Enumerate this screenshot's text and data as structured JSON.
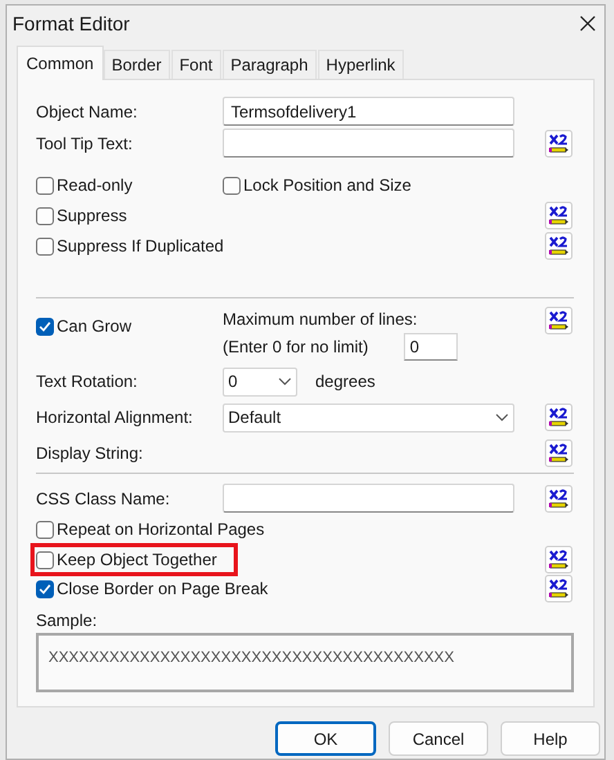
{
  "window": {
    "title": "Format Editor"
  },
  "tabs": [
    {
      "label": "Common",
      "selected": true
    },
    {
      "label": "Border",
      "selected": false
    },
    {
      "label": "Font",
      "selected": false
    },
    {
      "label": "Paragraph",
      "selected": false
    },
    {
      "label": "Hyperlink",
      "selected": false
    }
  ],
  "rows": [
    {
      "kind": "text",
      "label": "Object Name:",
      "value": "Termsofdelivery1",
      "formula": false
    },
    {
      "kind": "text",
      "label": "Tool Tip Text:",
      "formula": true
    },
    {
      "kind": "checks",
      "items": [
        {
          "label": "Read-only",
          "checked": false
        },
        {
          "label": "Lock Position and Size",
          "checked": false
        }
      ],
      "formula": false
    },
    {
      "kind": "check",
      "label": "Suppress",
      "checked": false,
      "formula": true,
      "highlighted": false
    },
    {
      "kind": "check",
      "label": "Suppress If Duplicated",
      "checked": false,
      "formula": true,
      "highlighted": false
    },
    {
      "kind": "divider"
    },
    {
      "kind": "grow",
      "label": "Can Grow",
      "checked": true,
      "max_label": "Maximum number of lines:",
      "max_hint": "(Enter 0 for no limit)",
      "max_value": "0",
      "formula": true
    },
    {
      "kind": "rotation",
      "label": "Text Rotation:",
      "value": "0",
      "unit": "degrees",
      "formula": false
    },
    {
      "kind": "select",
      "label": "Horizontal Alignment:",
      "value": "Default",
      "formula": true
    },
    {
      "kind": "label",
      "label": "Display String:",
      "formula": true
    },
    {
      "kind": "divider"
    },
    {
      "kind": "text",
      "label": "CSS Class Name:",
      "formula": true
    },
    {
      "kind": "check",
      "label": "Repeat on Horizontal Pages",
      "checked": false,
      "formula": false,
      "highlighted": false
    },
    {
      "kind": "check",
      "label": "Keep Object Together",
      "checked": false,
      "formula": true,
      "highlighted": true
    },
    {
      "kind": "check",
      "label": "Close Border on Page Break",
      "checked": true,
      "formula": true,
      "highlighted": false
    }
  ],
  "sample": {
    "label": "Sample:",
    "text": "XXXXXXXXXXXXXXXXXXXXXXXXXXXXXXXXXXXXXXXX"
  },
  "buttons": [
    {
      "label": "OK",
      "default": true
    },
    {
      "label": "Cancel",
      "default": false
    },
    {
      "label": "Help",
      "default": false
    }
  ]
}
